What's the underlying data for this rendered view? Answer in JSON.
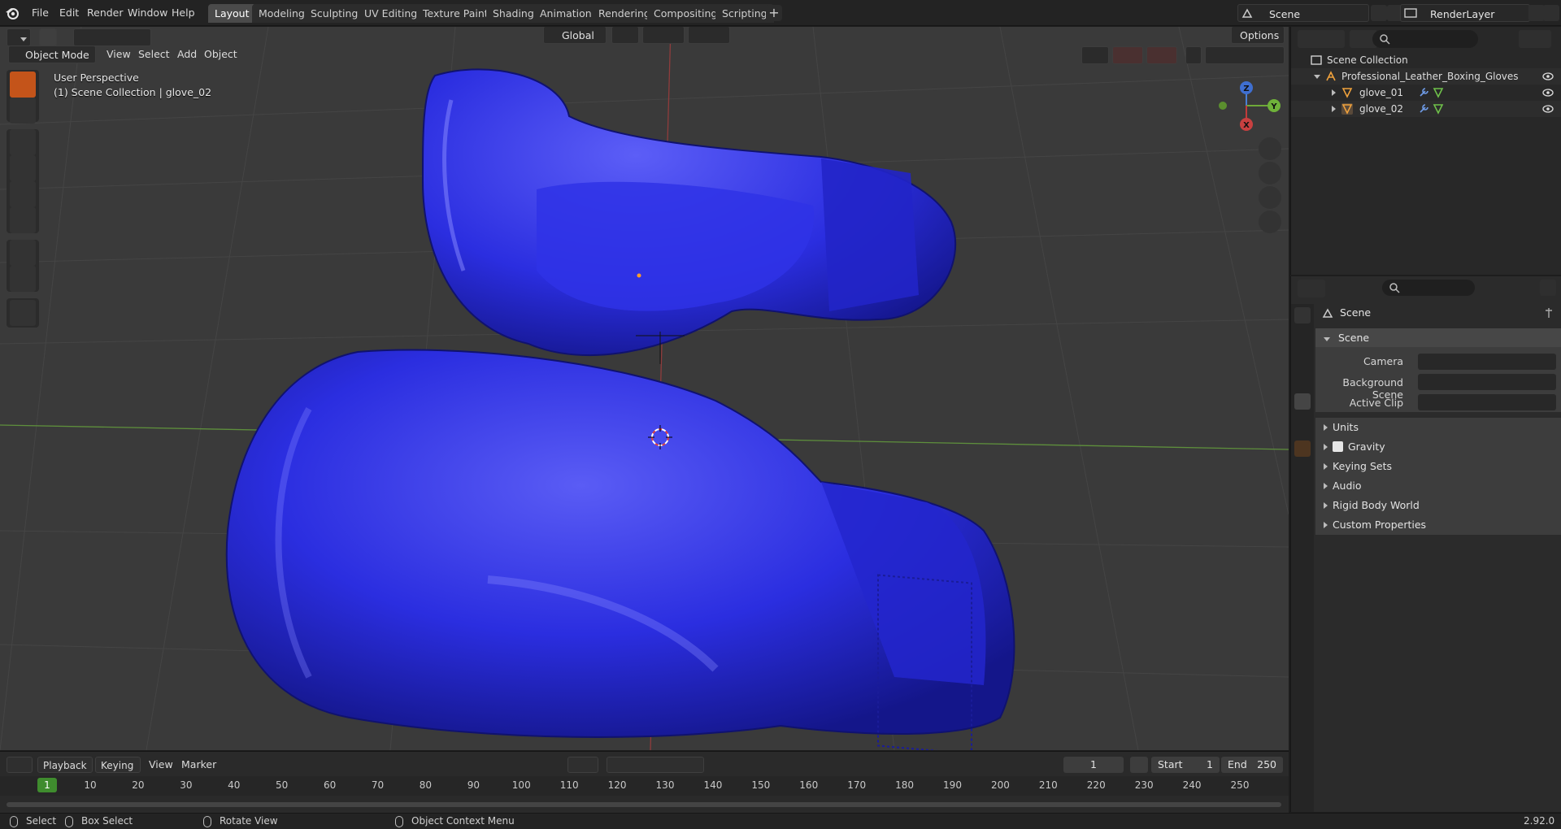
{
  "topbar": {
    "menus": [
      "File",
      "Edit",
      "Render",
      "Window",
      "Help"
    ],
    "tabs": [
      {
        "label": "Layout",
        "active": true
      },
      {
        "label": "Modeling",
        "active": false
      },
      {
        "label": "Sculpting",
        "active": false
      },
      {
        "label": "UV Editing",
        "active": false
      },
      {
        "label": "Texture Paint",
        "active": false
      },
      {
        "label": "Shading",
        "active": false
      },
      {
        "label": "Animation",
        "active": false
      },
      {
        "label": "Rendering",
        "active": false
      },
      {
        "label": "Compositing",
        "active": false
      },
      {
        "label": "Scripting",
        "active": false
      }
    ],
    "add_tab": "+",
    "scene_name": "Scene",
    "view_layer": "RenderLayer"
  },
  "viewport": {
    "mode": "Object Mode",
    "menus": [
      "View",
      "Select",
      "Add",
      "Object"
    ],
    "orientation": "Global",
    "options_label": "Options",
    "overlay_line1": "User Perspective",
    "overlay_line2": "(1) Scene Collection | glove_02",
    "gizmo": {
      "x": "X",
      "y": "Y",
      "z": "Z"
    },
    "object_color": "#2b2ee0"
  },
  "timeline": {
    "menus": {
      "playback": "Playback",
      "keying": "Keying",
      "view": "View",
      "marker": "Marker"
    },
    "current_frame": "1",
    "start_label": "Start",
    "start_value": "1",
    "end_label": "End",
    "end_value": "250",
    "ticks": [
      "1",
      "10",
      "20",
      "30",
      "40",
      "50",
      "60",
      "70",
      "80",
      "90",
      "100",
      "110",
      "120",
      "130",
      "140",
      "150",
      "160",
      "170",
      "180",
      "190",
      "200",
      "210",
      "220",
      "230",
      "240",
      "250"
    ]
  },
  "statusbar": {
    "select": "Select",
    "box_select": "Box Select",
    "rotate_view": "Rotate View",
    "context_menu": "Object Context Menu",
    "version": "2.92.0"
  },
  "outliner": {
    "root": "Scene Collection",
    "collection": "Professional_Leather_Boxing_Gloves",
    "objects": [
      "glove_01",
      "glove_02"
    ]
  },
  "properties": {
    "context_title": "Scene",
    "panel_title": "Scene",
    "camera_label": "Camera",
    "background_label": "Background Scene",
    "clip_label": "Active Clip",
    "subpanels": [
      {
        "label": "Units",
        "checkbox": false
      },
      {
        "label": "Gravity",
        "checkbox": true
      },
      {
        "label": "Keying Sets",
        "checkbox": false
      },
      {
        "label": "Audio",
        "checkbox": false
      },
      {
        "label": "Rigid Body World",
        "checkbox": false
      },
      {
        "label": "Custom Properties",
        "checkbox": false
      }
    ]
  }
}
